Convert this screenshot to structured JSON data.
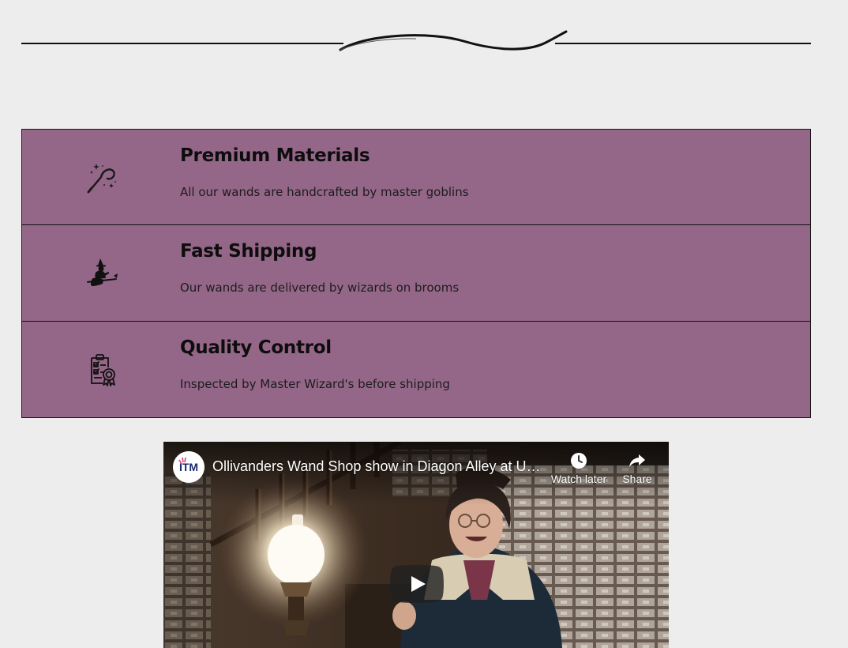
{
  "features": [
    {
      "icon": "magic-wand-icon",
      "title": "Premium Materials",
      "description": "All our wands are handcrafted by master goblins"
    },
    {
      "icon": "witch-on-broom-icon",
      "title": "Fast Shipping",
      "description": "Our wands are delivered by wizards on brooms"
    },
    {
      "icon": "quality-checklist-icon",
      "title": "Quality Control",
      "description": "Inspected by Master Wizard's before shipping"
    }
  ],
  "colors": {
    "background": "#ededed",
    "feature_background": "#946788",
    "feature_border": "#1a1a1a"
  },
  "video": {
    "title": "Ollivanders Wand Shop show in Diagon Alley at Universal Orlando",
    "channel_logo_text": "ITM",
    "watch_later_label": "Watch later",
    "share_label": "Share",
    "play_icon": "play-icon"
  }
}
